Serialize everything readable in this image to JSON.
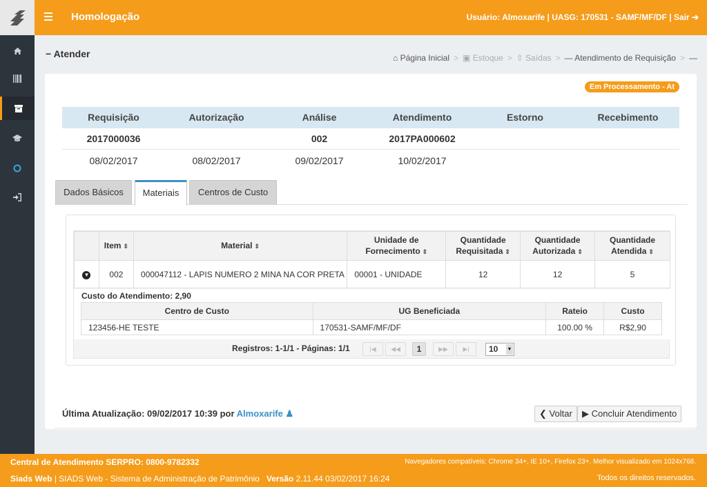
{
  "header": {
    "env": "Homologação",
    "user_info": "Usuário: Almoxarife | UASG: 170531 - SAMF/MF/DF | Sair"
  },
  "sidebar": {
    "items": [
      {
        "icon": "home-icon"
      },
      {
        "icon": "barcode-icon"
      },
      {
        "icon": "archive-icon",
        "active": true
      },
      {
        "icon": "graduation-cap-icon"
      },
      {
        "icon": "circle-icon"
      },
      {
        "icon": "sign-in-icon"
      }
    ]
  },
  "page": {
    "title": "Atender",
    "breadcrumb": [
      "Página Inicial",
      "Estoque",
      "Saídas",
      "Atendimento de Requisição"
    ]
  },
  "status": "Em Processamento - At",
  "summary": {
    "headers": [
      "Requisição",
      "Autorização",
      "Análise",
      "Atendimento",
      "Estorno",
      "Recebimento"
    ],
    "codes": [
      "2017000036",
      "",
      "002",
      "2017PA000602",
      "",
      ""
    ],
    "dates": [
      "08/02/2017",
      "08/02/2017",
      "09/02/2017",
      "10/02/2017",
      "",
      ""
    ]
  },
  "tabs": [
    "Dados Básicos",
    "Materiais",
    "Centros de Custo"
  ],
  "materials": {
    "headers": [
      "Item",
      "Material",
      "Unidade de Fornecimento",
      "Quantidade Requisitada",
      "Quantidade Autorizada",
      "Quantidade Atendida"
    ],
    "rows": [
      {
        "item": "002",
        "material": "000047112 - LAPIS NUMERO 2 MINA NA COR PRETA",
        "unidade": "00001 - UNIDADE",
        "req": "12",
        "aut": "12",
        "atend": "5"
      }
    ],
    "custo_label": "Custo do Atendimento: 2,90",
    "cc_headers": [
      "Centro de Custo",
      "UG Beneficiada",
      "Rateio",
      "Custo"
    ],
    "cc_rows": [
      {
        "centro": "123456-HE TESTE",
        "ug": "170531-SAMF/MF/DF",
        "rateio": "100.00 %",
        "custo": "R$2,90"
      }
    ],
    "pager_text": "Registros: 1-1/1 - Páginas: 1/1",
    "current_page": "1",
    "page_size": "10"
  },
  "footer": {
    "last_update_label": "Última Atualização: 09/02/2017 10:39 por",
    "last_update_user": "Almoxarife",
    "back_label": "Voltar",
    "conclude_label": "Concluir Atendimento"
  },
  "bottom": {
    "central": "Central de Atendimento SERPRO: 0800-9782332",
    "browsers": "Navegadores compatíveis: Chrome 34+, IE 10+, Firefox 23+. Melhor visualizado em 1024x768.",
    "system_name": "Siads Web",
    "system_desc": "| SIADS Web - Sistema de Administração de Patrimônio",
    "version_label": "Versão",
    "version": "2.11.44 03/02/2017 16:24",
    "rights": "Todos os direitos reservados."
  },
  "colors": {
    "brand": "#f59c1a",
    "sidebar": "#2d353c",
    "accent": "#3b8fc6"
  }
}
